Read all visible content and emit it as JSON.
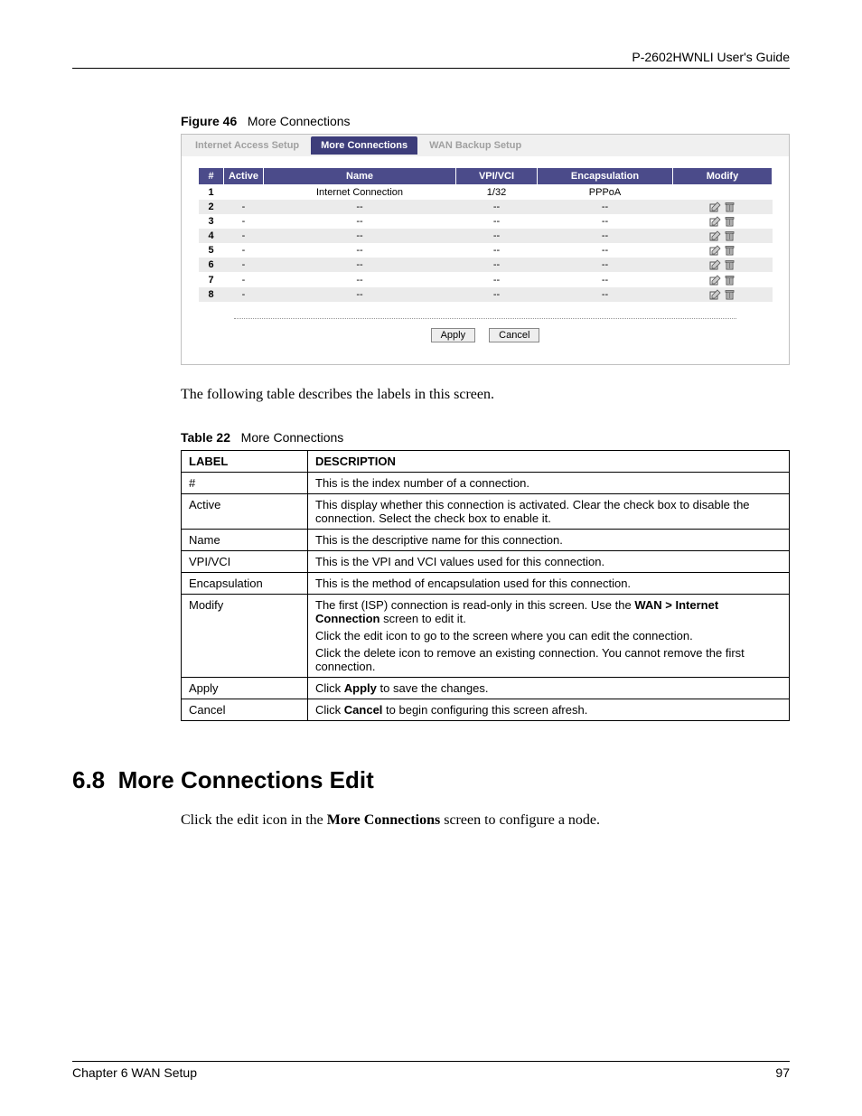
{
  "header": {
    "guide_title": "P-2602HWNLI User's Guide"
  },
  "figure": {
    "label": "Figure 46",
    "title": "More Connections"
  },
  "ui": {
    "tabs": [
      {
        "label": "Internet Access Setup",
        "active": false
      },
      {
        "label": "More Connections",
        "active": true
      },
      {
        "label": "WAN Backup Setup",
        "active": false
      }
    ],
    "columns": {
      "idx": "#",
      "active": "Active",
      "name": "Name",
      "vpivci": "VPI/VCI",
      "encap": "Encapsulation",
      "modify": "Modify"
    },
    "rows": [
      {
        "idx": "1",
        "active": "",
        "name": "Internet Connection",
        "vpivci": "1/32",
        "encap": "PPPoA",
        "modify": false
      },
      {
        "idx": "2",
        "active": "-",
        "name": "--",
        "vpivci": "--",
        "encap": "--",
        "modify": true
      },
      {
        "idx": "3",
        "active": "-",
        "name": "--",
        "vpivci": "--",
        "encap": "--",
        "modify": true
      },
      {
        "idx": "4",
        "active": "-",
        "name": "--",
        "vpivci": "--",
        "encap": "--",
        "modify": true
      },
      {
        "idx": "5",
        "active": "-",
        "name": "--",
        "vpivci": "--",
        "encap": "--",
        "modify": true
      },
      {
        "idx": "6",
        "active": "-",
        "name": "--",
        "vpivci": "--",
        "encap": "--",
        "modify": true
      },
      {
        "idx": "7",
        "active": "-",
        "name": "--",
        "vpivci": "--",
        "encap": "--",
        "modify": true
      },
      {
        "idx": "8",
        "active": "-",
        "name": "--",
        "vpivci": "--",
        "encap": "--",
        "modify": true
      }
    ],
    "buttons": {
      "apply": "Apply",
      "cancel": "Cancel"
    }
  },
  "intro_para": "The following table describes the labels in this screen.",
  "table_caption": {
    "label": "Table 22",
    "title": "More Connections"
  },
  "desc_headers": {
    "label": "LABEL",
    "description": "DESCRIPTION"
  },
  "desc_rows": [
    {
      "label": "#",
      "desc": [
        "This is the index number of a connection."
      ]
    },
    {
      "label": "Active",
      "desc": [
        "This display whether this connection is activated. Clear the check box to disable the connection. Select the check box to enable it."
      ]
    },
    {
      "label": "Name",
      "desc": [
        "This is the descriptive name for this connection."
      ]
    },
    {
      "label": "VPI/VCI",
      "desc": [
        "This is the VPI and VCI values used for this connection."
      ]
    },
    {
      "label": "Encapsulation",
      "desc": [
        "This is the method of encapsulation used for this connection."
      ]
    },
    {
      "label": "Modify",
      "desc": [
        "The first (ISP) connection is read-only in this screen. Use the <b>WAN > Internet Connection</b> screen to edit it.",
        "Click the edit icon to go to the screen where you can edit the connection.",
        "Click the delete icon to remove an existing connection. You cannot remove the first connection."
      ]
    },
    {
      "label": "Apply",
      "desc": [
        "Click <b>Apply</b> to save the changes."
      ]
    },
    {
      "label": "Cancel",
      "desc": [
        "Click <b>Cancel</b> to begin configuring this screen afresh."
      ]
    }
  ],
  "section": {
    "number": "6.8",
    "title": "More Connections Edit"
  },
  "section_body": "Click the edit icon in the <b>More Connections</b> screen to configure a node.",
  "footer": {
    "chapter": "Chapter 6 WAN Setup",
    "page": "97"
  }
}
